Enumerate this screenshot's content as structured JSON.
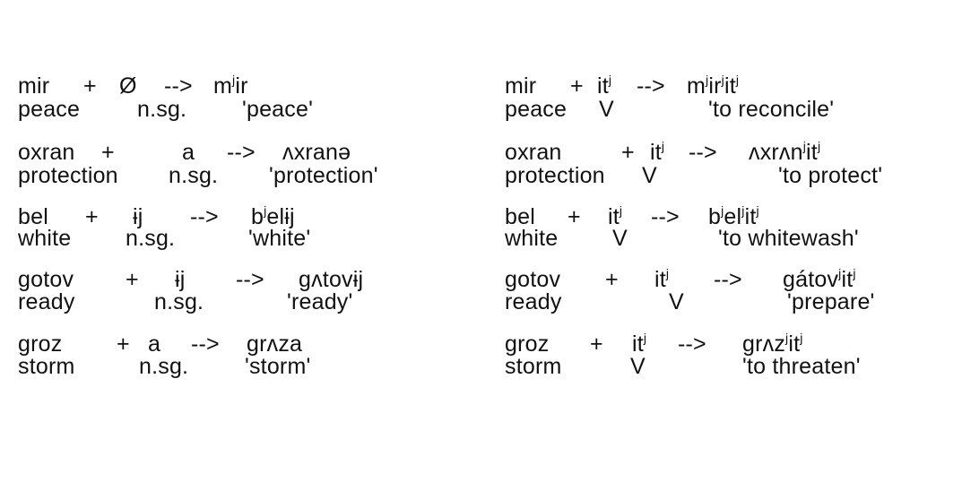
{
  "entries": [
    {
      "noun": {
        "stem": "mir",
        "plus": "+",
        "suffix": "Ø",
        "arrow": "-->",
        "result_base": "m",
        "result_sup": "j",
        "result_rest": "ir",
        "result_tail": "",
        "result_sup2": "",
        "gloss": "peace",
        "category": "n.sg.",
        "meaning": "'peace'"
      },
      "verb": {
        "stem": "mir",
        "plus": "+",
        "suffix_base": "it",
        "suffix_sup": "j",
        "arrow": "-->",
        "result_a": "m",
        "result_a_sup": "j",
        "result_b": "ir",
        "result_b_sup": "j",
        "result_c": "it",
        "result_c_sup": "j",
        "gloss": "peace",
        "category": "V",
        "meaning": "'to reconcile'"
      }
    },
    {
      "noun": {
        "stem": "oxran",
        "plus": "+",
        "suffix": "a",
        "arrow": "-->",
        "result_base": "ʌxranə",
        "result_sup": "",
        "result_rest": "",
        "result_tail": "",
        "result_sup2": "",
        "gloss": "protection",
        "category": "n.sg.",
        "meaning": "'protection'"
      },
      "verb": {
        "stem": "oxran",
        "plus": "+",
        "suffix_base": "it",
        "suffix_sup": "j",
        "arrow": "-->",
        "result_a": "ʌxrʌn",
        "result_a_sup": "j",
        "result_b": "it",
        "result_b_sup": "j",
        "result_c": "",
        "result_c_sup": "",
        "gloss": "protection",
        "category": "V",
        "meaning": "'to protect'"
      }
    },
    {
      "noun": {
        "stem": "bel",
        "plus": "+",
        "suffix": "ɨj",
        "arrow": "-->",
        "result_base": "b",
        "result_sup": "j",
        "result_rest": "elɨj",
        "result_tail": "",
        "result_sup2": "",
        "gloss": "white",
        "category": "n.sg.",
        "meaning": "'white'"
      },
      "verb": {
        "stem": "bel",
        "plus": "+",
        "suffix_base": "it",
        "suffix_sup": "j",
        "arrow": "-->",
        "result_a": "b",
        "result_a_sup": "j",
        "result_b": "el",
        "result_b_sup": "j",
        "result_c": "it",
        "result_c_sup": "j",
        "gloss": "white",
        "category": "V",
        "meaning": "'to whitewash'"
      }
    },
    {
      "noun": {
        "stem": "gotov",
        "plus": "+",
        "suffix": "ɨj",
        "arrow": "-->",
        "result_base": "gʌtovɨj",
        "result_sup": "",
        "result_rest": "",
        "result_tail": "",
        "result_sup2": "",
        "gloss": "ready",
        "category": "n.sg.",
        "meaning": "'ready'"
      },
      "verb": {
        "stem": "gotov",
        "plus": "+",
        "suffix_base": "it",
        "suffix_sup": "j",
        "arrow": "-->",
        "result_a": "gátov",
        "result_a_sup": "j",
        "result_b": "it",
        "result_b_sup": "j",
        "result_c": "",
        "result_c_sup": "",
        "gloss": "ready",
        "category": "V",
        "meaning": "'prepare'"
      }
    },
    {
      "noun": {
        "stem": "groz",
        "plus": "+",
        "suffix": "a",
        "arrow": "-->",
        "result_base": "grʌza",
        "result_sup": "",
        "result_rest": "",
        "result_tail": "",
        "result_sup2": "",
        "gloss": "storm",
        "category": "n.sg.",
        "meaning": "'storm'"
      },
      "verb": {
        "stem": "groz",
        "plus": "+",
        "suffix_base": "it",
        "suffix_sup": "j",
        "arrow": "-->",
        "result_a": "grʌz",
        "result_a_sup": "j",
        "result_b": "it",
        "result_b_sup": "j",
        "result_c": "",
        "result_c_sup": "",
        "gloss": "storm",
        "category": "V",
        "meaning": "'to threaten'"
      }
    }
  ]
}
